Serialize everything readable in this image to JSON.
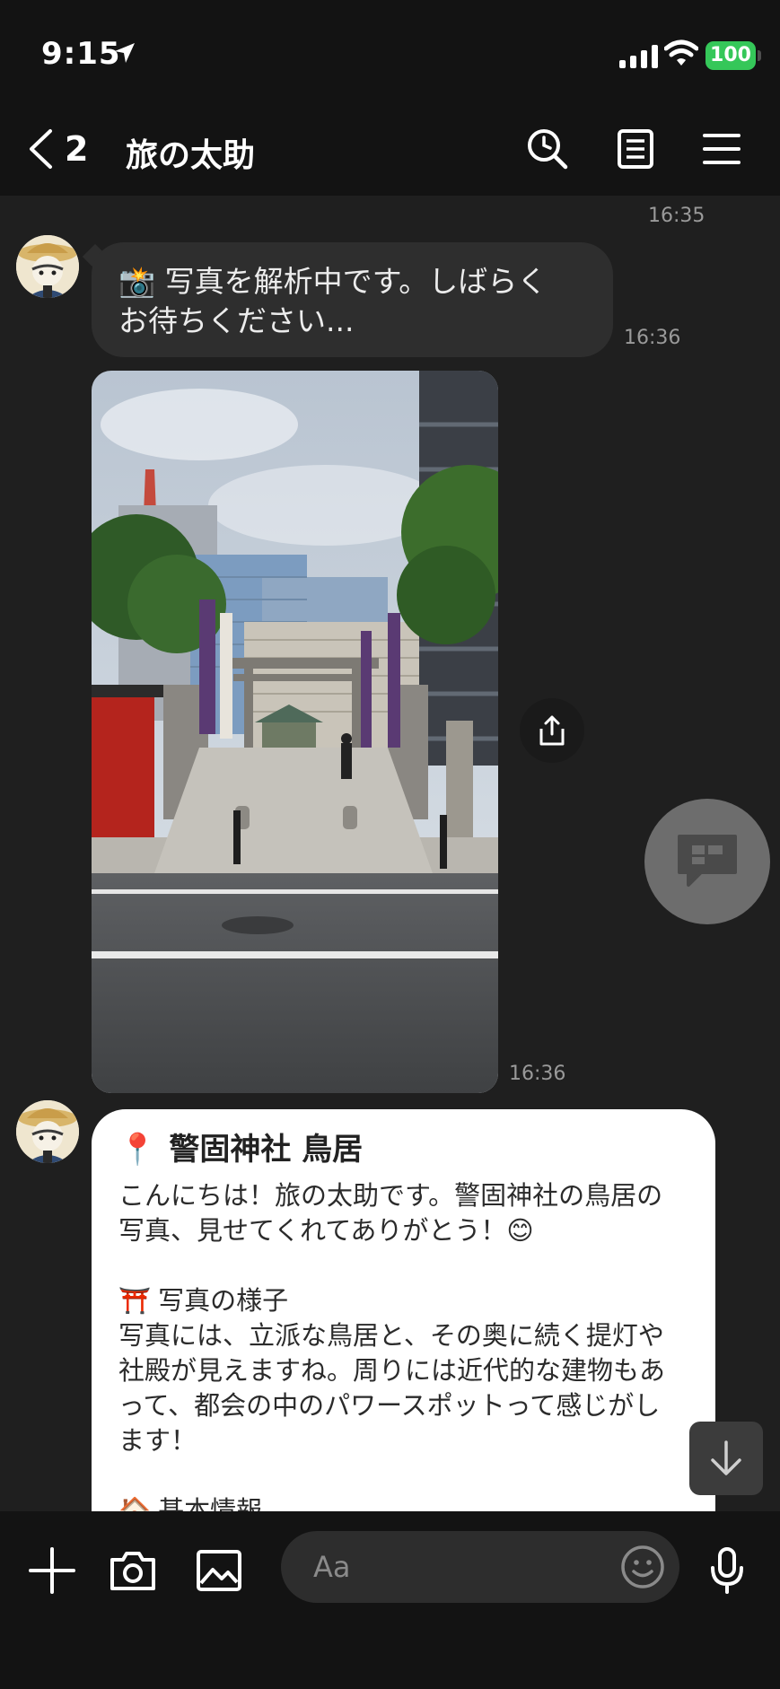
{
  "status_bar": {
    "time": "9:15",
    "battery": "100"
  },
  "header": {
    "back_count": "2",
    "title": "旅の太助",
    "icons": [
      "search-icon",
      "notes-icon",
      "menu-icon"
    ]
  },
  "messages": {
    "top_timestamp": "16:35",
    "analyzing": {
      "emoji": "📸",
      "text": "写真を解析中です。しばらく\nお待ちください...",
      "time": "16:36"
    },
    "photo": {
      "time": "16:36"
    },
    "reply": {
      "title_emoji": "📍",
      "title": "警固神社 鳥居",
      "greeting": "こんにちは！旅の太助です。警固神社の鳥居の\n写真、見せてくれてありがとう！😊",
      "section1_emoji": "⛩️",
      "section1_title": "写真の様子",
      "section1_body": "写真には、立派な鳥居と、その奥に続く提灯や\n社殿が見えますね。周りには近代的な建物もあ\nって、都会の中のパワースポットって感じがし\nます！",
      "section2_emoji": "🏠",
      "section2_title": "基本情報"
    }
  },
  "input": {
    "placeholder": "Aa"
  },
  "colors": {
    "background": "#1f1f1f",
    "header": "#131313",
    "bubble_dark": "#2e2e2e",
    "bubble_white": "#ffffff",
    "battery": "#35c759"
  }
}
